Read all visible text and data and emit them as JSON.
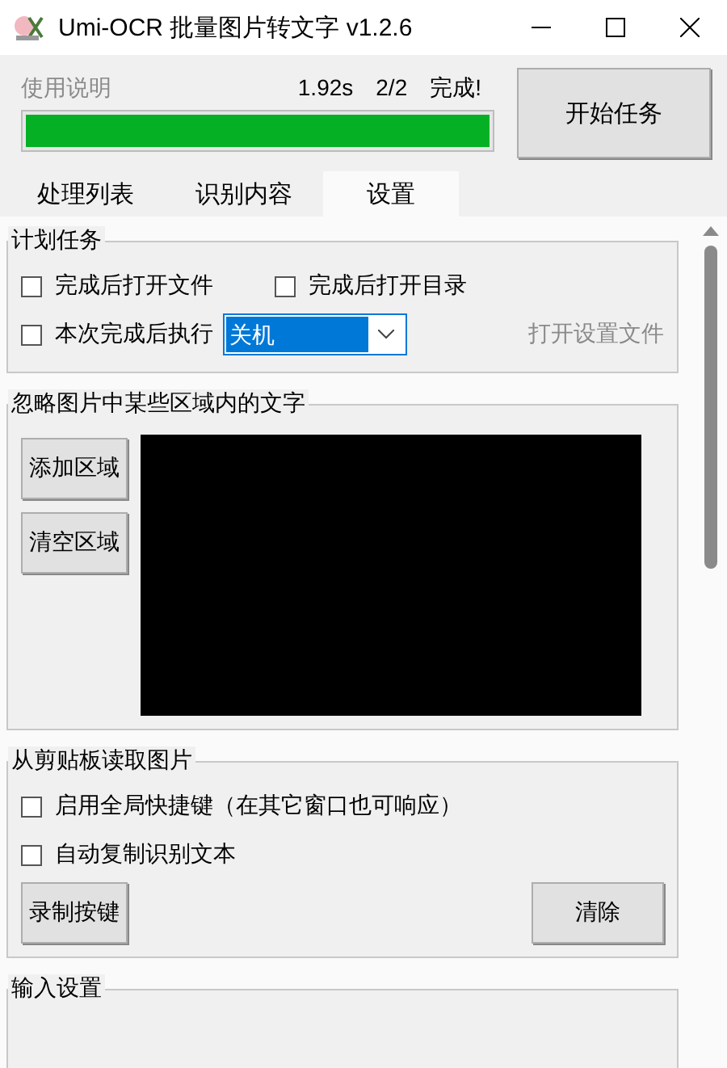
{
  "window": {
    "title": "Umi-OCR 批量图片转文字 v1.2.6"
  },
  "header": {
    "help_link": "使用说明",
    "elapsed": "1.92s",
    "count": "2/2",
    "status": "完成!",
    "progress": {
      "level": 1
    },
    "start_button": "开始任务"
  },
  "tabs": [
    {
      "label": "处理列表",
      "selected": false
    },
    {
      "label": "识别内容",
      "selected": false
    },
    {
      "label": "设置",
      "selected": true
    }
  ],
  "schedule": {
    "title": "计划任务",
    "options": [
      {
        "label": "完成后打开文件",
        "checked": false
      },
      {
        "label": "完成后打开目录",
        "checked": false
      }
    ],
    "run_after": {
      "label": "本次完成后执行",
      "checked": false,
      "value": "关机"
    },
    "settings_link": "打开设置文件"
  },
  "ignore_regions": {
    "title": "忽略图片中某些区域内的文字",
    "buttons": [
      "添加区域",
      "清空区域"
    ]
  },
  "clipboard": {
    "title": "从剪贴板读取图片",
    "options": [
      {
        "label": "启用全局快捷键（在其它窗口也可响应）",
        "checked": false
      },
      {
        "label": "自动复制识别文本",
        "checked": false
      }
    ],
    "record_button": "录制按键",
    "clear_button": "清除"
  },
  "input_settings": {
    "title": "输入设置"
  }
}
